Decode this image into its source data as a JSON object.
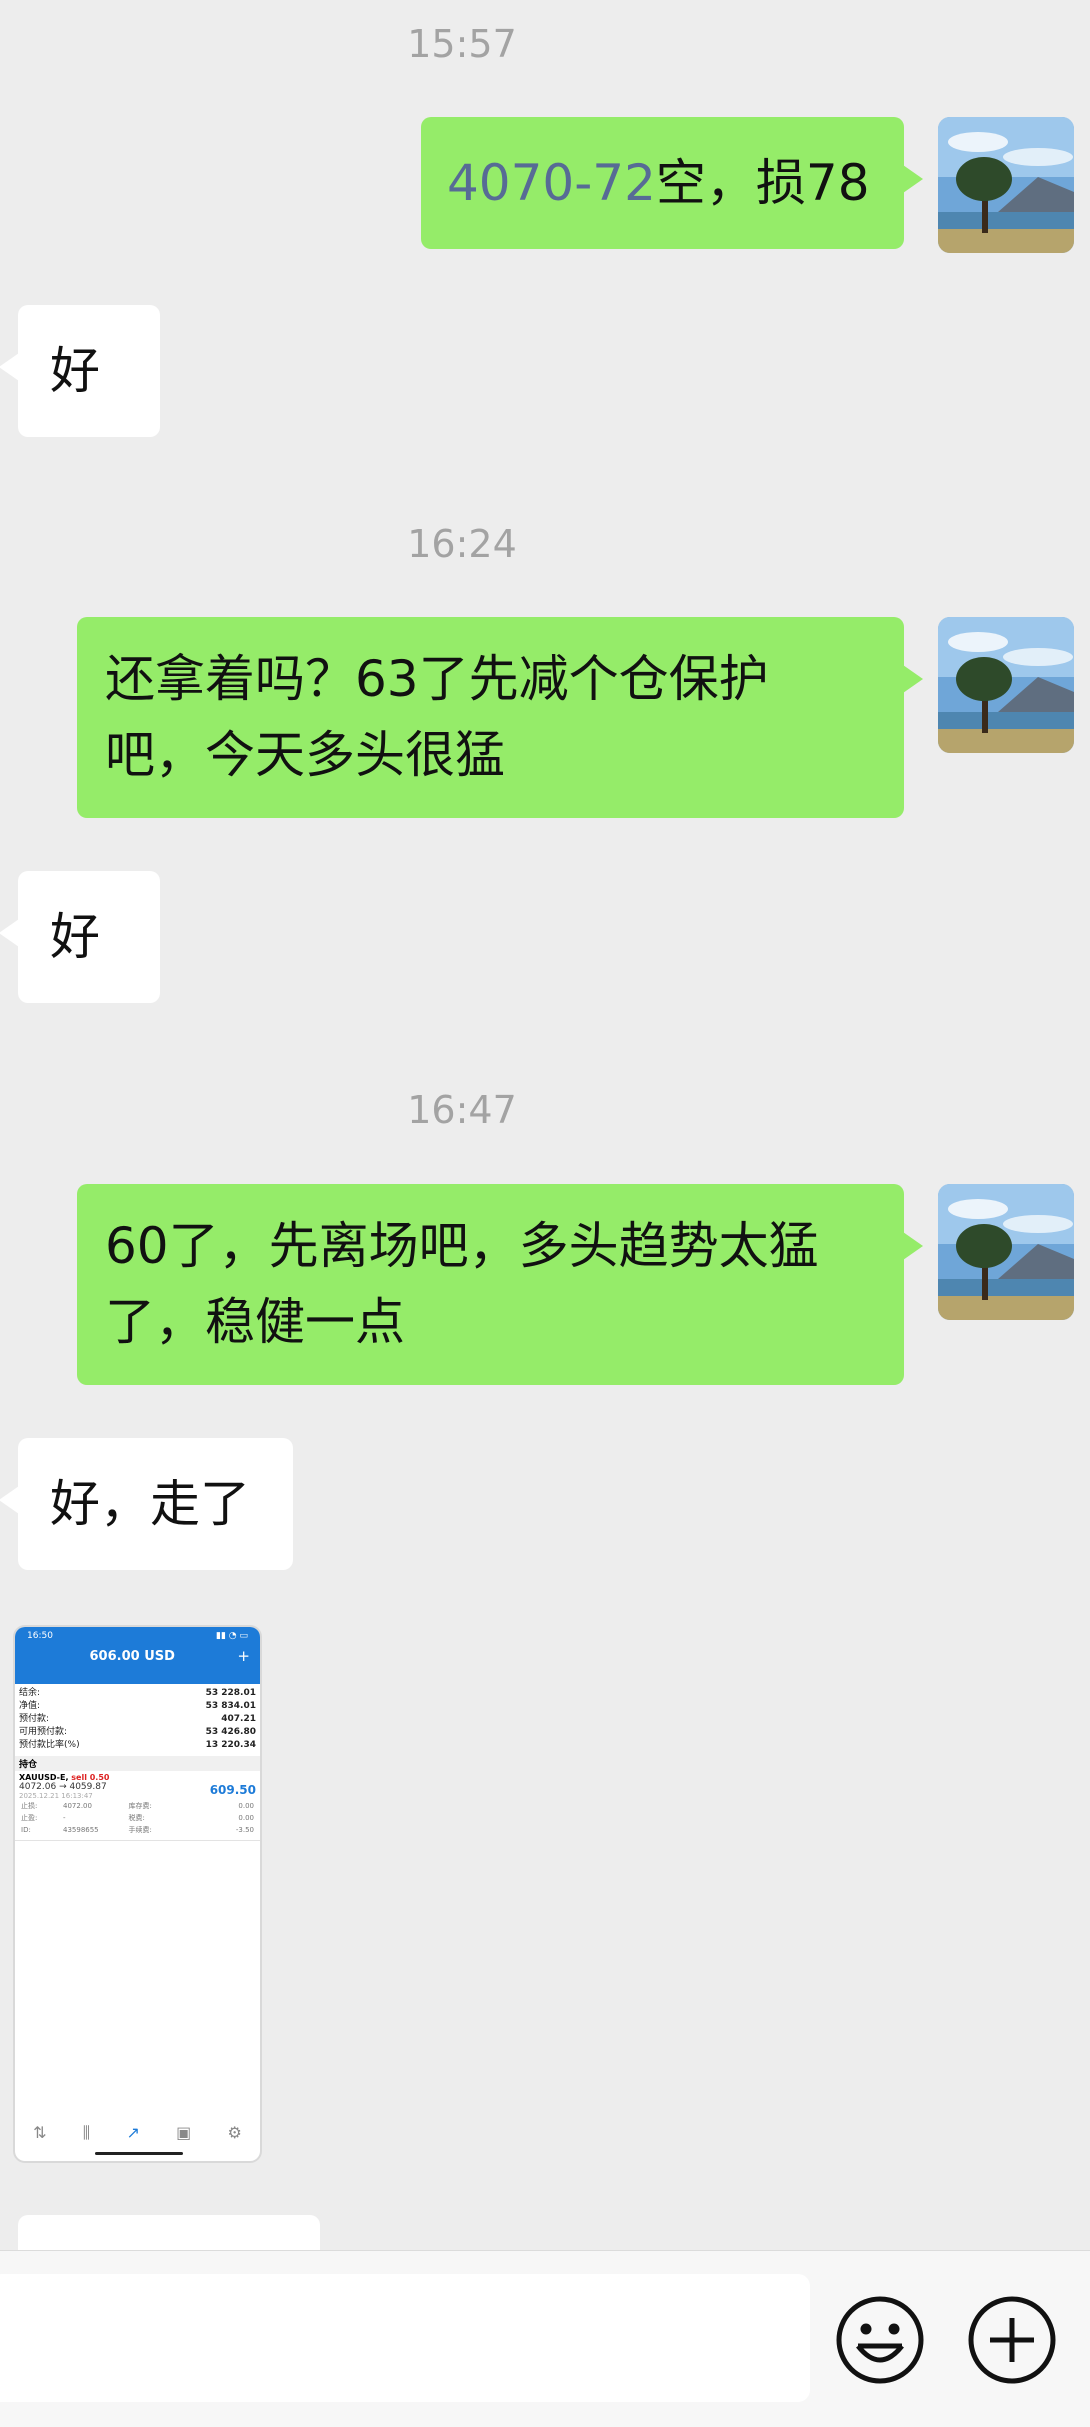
{
  "chat": {
    "time1": "15:57",
    "msg1_num": "4070-72",
    "msg1_rest": "空，损78",
    "reply1": "好",
    "time2": "16:24",
    "msg2_line1": "还拿着吗？63了先减个仓保护",
    "msg2_line2": "吧，今天多头很猛",
    "reply2": "好",
    "time3": "16:47",
    "msg3_line1": "60了，先离场吧，多头趋势太猛",
    "msg3_line2": "了，稳健一点",
    "reply3": "好，走了"
  },
  "screenshot": {
    "status_time": "16:50",
    "balance_title": "606.00 USD",
    "plus": "+",
    "rows": [
      {
        "label": "结余:",
        "value": "53 228.01"
      },
      {
        "label": "净值:",
        "value": "53 834.01"
      },
      {
        "label": "预付款:",
        "value": "407.21"
      },
      {
        "label": "可用预付款:",
        "value": "53 426.80"
      },
      {
        "label": "预付款比率(%)",
        "value": "13 220.34"
      }
    ],
    "section": "持仓",
    "symbol": "XAUUSD-E,",
    "side": "sell 0.50",
    "prices": "4072.06 → 4059.87",
    "profit": "609.50",
    "date": "2025.12.21 16:13:47",
    "details": [
      [
        "止损:",
        "4072.00",
        "库存费:",
        "0.00"
      ],
      [
        "止盈:",
        "-",
        "税费:",
        "0.00"
      ],
      [
        "ID:",
        "43598655",
        "手续费:",
        "-3.50"
      ]
    ]
  },
  "colors": {
    "background": "#ededed",
    "my_bubble": "#95ec69",
    "their_bubble": "#ffffff",
    "link": "#576b95",
    "app_blue": "#1d7bd8"
  },
  "icons": {
    "emoji": "smiley-face-icon",
    "more": "plus-circle-icon"
  }
}
